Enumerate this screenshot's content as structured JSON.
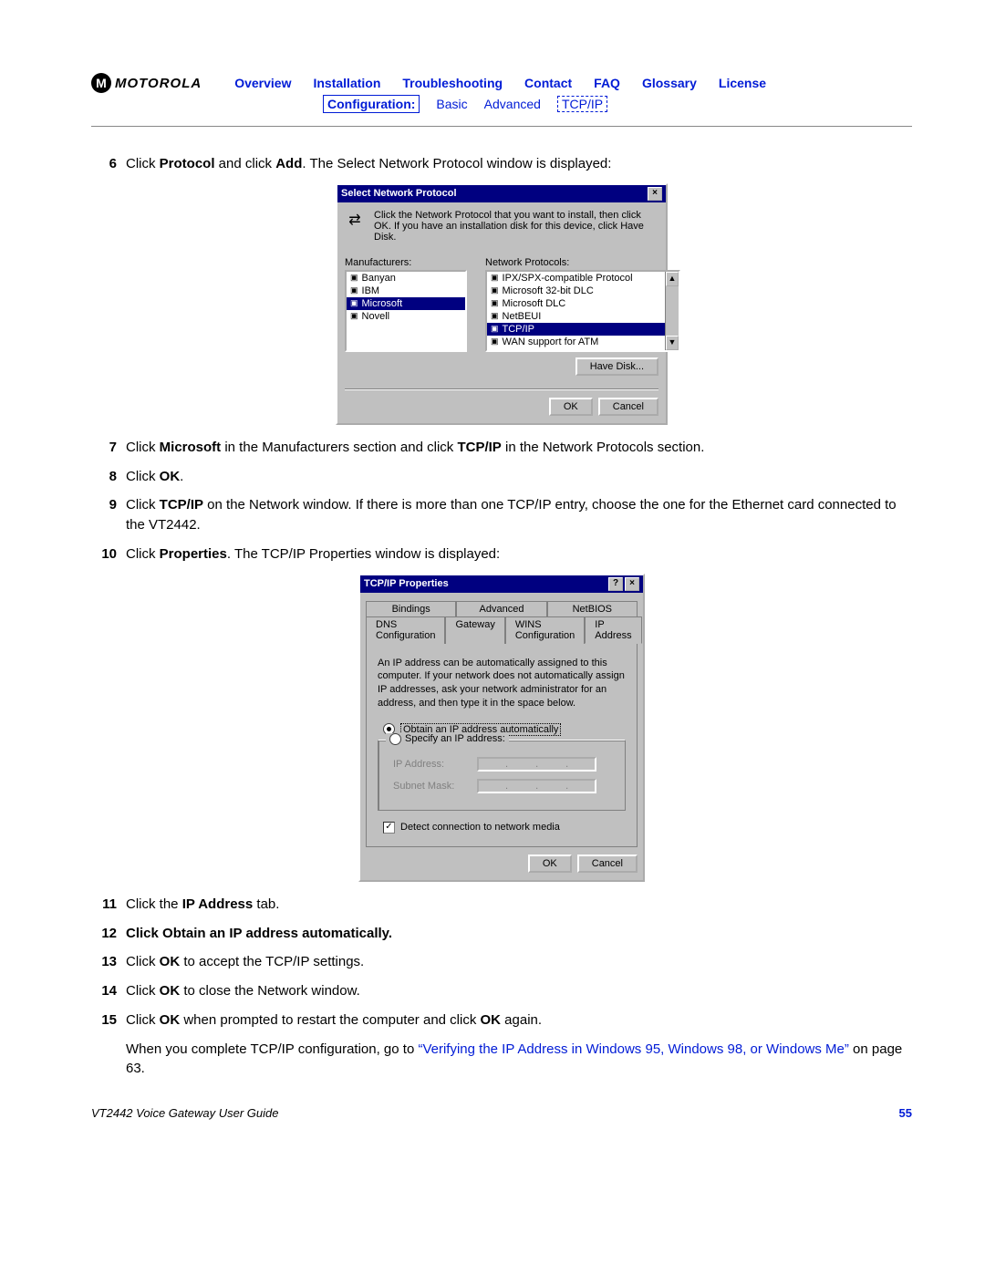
{
  "brand": {
    "logo_letter": "M",
    "name": "MOTOROLA"
  },
  "nav": {
    "top": [
      "Overview",
      "Installation",
      "Troubleshooting",
      "Contact",
      "FAQ",
      "Glossary",
      "License"
    ],
    "config_label": "Configuration:",
    "sub": [
      "Basic",
      "Advanced"
    ],
    "tcpip": "TCP/IP"
  },
  "steps": {
    "s6": {
      "num": "6",
      "pre": "Click ",
      "b1": "Protocol",
      "mid": " and click ",
      "b2": "Add",
      "post": ". The Select Network Protocol window is displayed:"
    },
    "s7": {
      "num": "7",
      "pre": "Click ",
      "b1": "Microsoft",
      "mid": " in the Manufacturers section and click ",
      "b2": "TCP/IP",
      "post": " in the Network Protocols section."
    },
    "s8": {
      "num": "8",
      "pre": "Click ",
      "b1": "OK",
      "post": "."
    },
    "s9": {
      "num": "9",
      "pre": "Click ",
      "b1": "TCP/IP",
      "post": " on the Network window. If there is more than one TCP/IP entry, choose the one for the Ethernet card connected to the VT2442."
    },
    "s10": {
      "num": "10",
      "pre": "Click ",
      "b1": "Properties",
      "post": ". The TCP/IP Properties window is displayed:"
    },
    "s11": {
      "num": "11",
      "pre": "Click the ",
      "b1": "IP Address",
      "post": " tab."
    },
    "s12": {
      "num": "12",
      "pre": "Click ",
      "b1": "Obtain an IP address automatically",
      "post": "."
    },
    "s13": {
      "num": "13",
      "pre": "Click ",
      "b1": "OK",
      "post": " to accept the TCP/IP settings."
    },
    "s14": {
      "num": "14",
      "pre": "Click ",
      "b1": "OK",
      "post": " to close the Network window."
    },
    "s15": {
      "num": "15",
      "pre": "Click ",
      "b1": "OK",
      "mid": " when prompted to restart the computer and click ",
      "b2": "OK",
      "post": " again."
    }
  },
  "after": {
    "pre": "When you complete TCP/IP configuration, go to ",
    "link": "“Verifying the IP Address in Windows 95, Windows 98, or Windows Me”",
    "post": " on page 63."
  },
  "dialog1": {
    "title": "Select Network Protocol",
    "intro": "Click the Network Protocol that you want to install, then click OK. If you have an installation disk for this device, click Have Disk.",
    "left_label": "Manufacturers:",
    "right_label": "Network Protocols:",
    "manufacturers": [
      "Banyan",
      "IBM",
      "Microsoft",
      "Novell"
    ],
    "manufacturer_selected": "Microsoft",
    "protocols": [
      "IPX/SPX-compatible Protocol",
      "Microsoft 32-bit DLC",
      "Microsoft DLC",
      "NetBEUI",
      "TCP/IP",
      "WAN support for ATM"
    ],
    "protocol_selected": "TCP/IP",
    "have_disk": "Have Disk...",
    "ok": "OK",
    "cancel": "Cancel"
  },
  "dialog2": {
    "title": "TCP/IP Properties",
    "tabs_row1": [
      "Bindings",
      "Advanced",
      "NetBIOS"
    ],
    "tabs_row2": [
      "DNS Configuration",
      "Gateway",
      "WINS Configuration",
      "IP Address"
    ],
    "active_tab": "IP Address",
    "panel_text": "An IP address can be automatically assigned to this computer. If your network does not automatically assign IP addresses, ask your network administrator for an address, and then type it in the space below.",
    "radio_auto": "Obtain an IP address automatically",
    "radio_specify": "Specify an IP address:",
    "ip_label": "IP Address:",
    "mask_label": "Subnet Mask:",
    "detect": "Detect connection to network media",
    "ok": "OK",
    "cancel": "Cancel"
  },
  "footer": {
    "title": "VT2442 Voice Gateway User Guide",
    "page": "55"
  }
}
